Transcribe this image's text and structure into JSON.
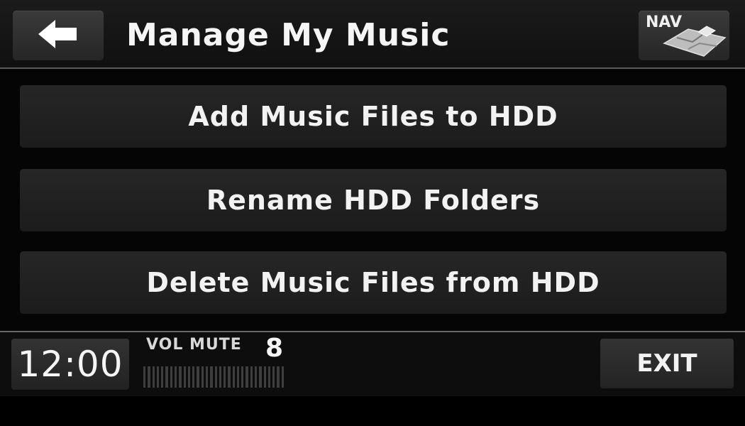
{
  "header": {
    "title": "Manage My Music",
    "back_icon": "arrow-left-icon",
    "nav_label": "NAV",
    "nav_icon": "map-icon"
  },
  "menu": {
    "items": [
      {
        "label": "Add Music Files to HDD"
      },
      {
        "label": "Rename HDD Folders"
      },
      {
        "label": "Delete Music Files from HDD"
      }
    ]
  },
  "footer": {
    "clock": "12:00",
    "volume_label": "VOL MUTE",
    "volume_value": "8",
    "exit_label": "EXIT"
  },
  "colors": {
    "background": "#050505",
    "button": "#2a2a2a",
    "text": "#f2f2f2"
  }
}
